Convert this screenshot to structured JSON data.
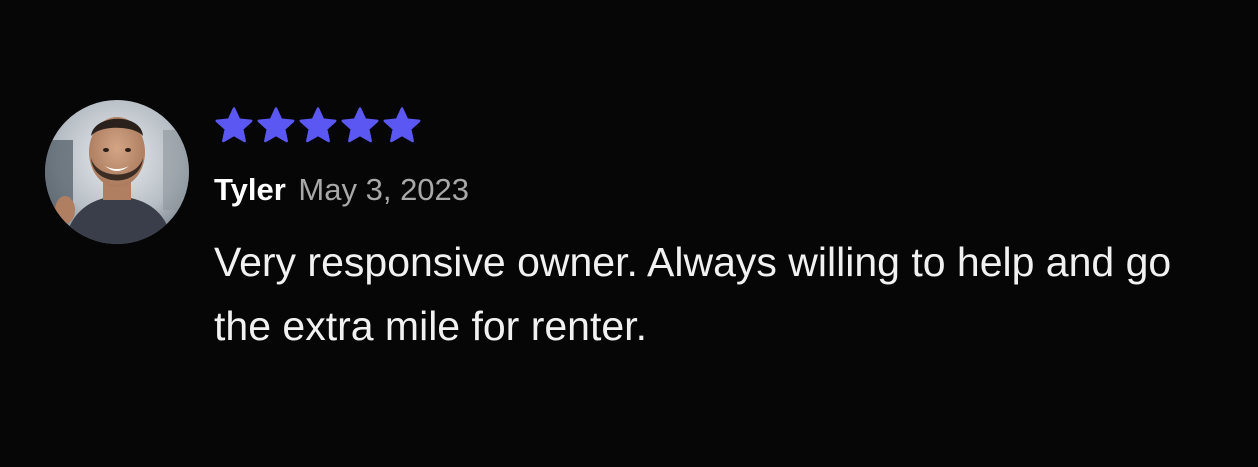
{
  "review": {
    "rating": 5,
    "rating_max": 5,
    "star_color": "#5b57f2",
    "reviewer_name": "Tyler",
    "date": "May 3, 2023",
    "text": "Very responsive owner. Always willing to help and go the extra mile for renter."
  },
  "avatar": {
    "icon": "user-photo-avatar"
  }
}
